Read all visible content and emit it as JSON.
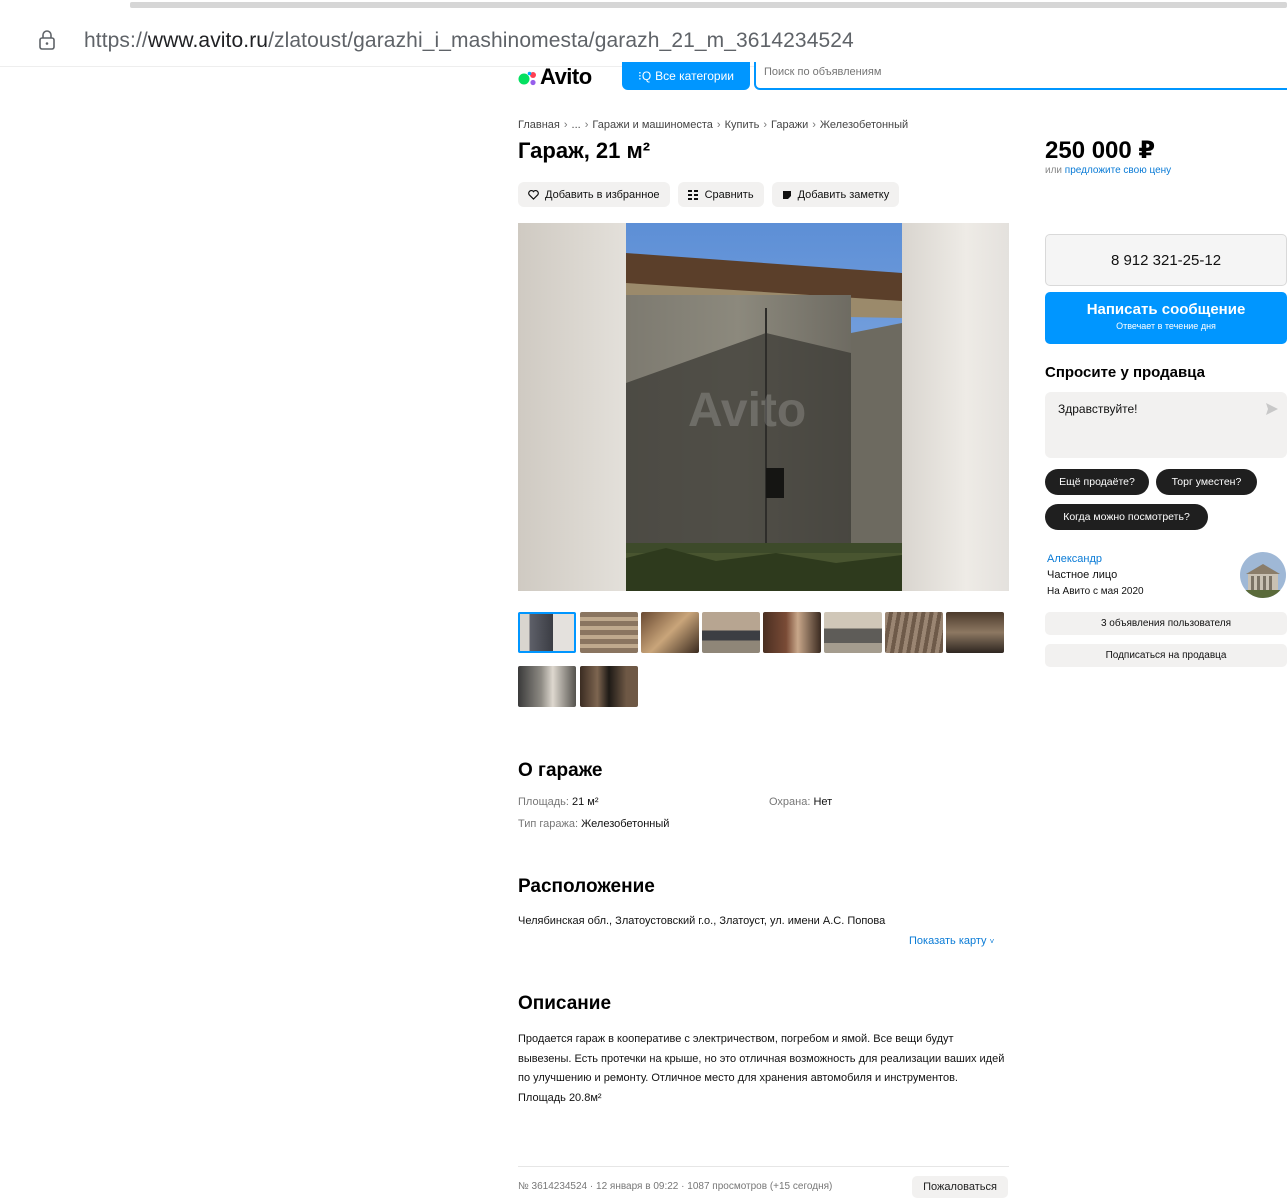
{
  "browser": {
    "url_prefix": "https://",
    "url_host": "www.avito.ru",
    "url_path": "/zlatoust/garazhi_i_mashinomesta/garazh_21_m_3614234524"
  },
  "header": {
    "logo": "Avito",
    "categories_button": "Все категории",
    "search_placeholder": "Поиск по объявлениям"
  },
  "breadcrumbs": [
    "Главная",
    "...",
    "Гаражи и машиноместа",
    "Купить",
    "Гаражи",
    "Железобетонный"
  ],
  "listing": {
    "title": "Гараж, 21 м²",
    "actions": {
      "favorite": "Добавить в избранное",
      "compare": "Сравнить",
      "note": "Добавить заметку"
    },
    "watermark": "Avito"
  },
  "about": {
    "heading": "О гараже",
    "area_label": "Площадь:",
    "area_value": "21 м²",
    "security_label": "Охрана:",
    "security_value": "Нет",
    "type_label": "Тип гаража:",
    "type_value": "Железобетонный"
  },
  "location": {
    "heading": "Расположение",
    "address": "Челябинская обл., Златоустовский г.о., Златоуст, ул. имени А.С. Попова",
    "map_link": "Показать карту"
  },
  "description": {
    "heading": "Описание",
    "text": "Продается гараж в кооперативе с электричеством, погребом и ямой. Все вещи будут вывезены. Есть протечки на крыше, но это отличная возможность для реализации ваших идей по улучшению и ремонту. Отличное место для хранения автомобиля и инструментов.",
    "area_line": "Площадь 20.8м²"
  },
  "footer": {
    "meta": "№ 3614234524 · 12 января в 09:22 · 1087 просмотров (+15 сегодня)",
    "complain": "Пожаловаться"
  },
  "sidebar": {
    "price": "250 000 ₽",
    "offer_prefix": "или",
    "offer_link": "предложите свою цену",
    "phone": "8 912 321-25-12",
    "message_button": "Написать сообщение",
    "message_sub": "Отвечает в течение дня",
    "ask_title": "Спросите у продавца",
    "ask_text": "Здравствуйте!",
    "chips": [
      "Ещё продаёте?",
      "Торг уместен?",
      "Когда можно посмотреть?"
    ],
    "seller_name": "Александр",
    "seller_type": "Частное лицо",
    "seller_since": "На Авито с мая 2020",
    "listings_button": "3 объявления пользователя",
    "subscribe_button": "Подписаться на продавца"
  },
  "colors": {
    "accent": "#0096ff",
    "link": "#0a7bd6",
    "chip": "#1f1f1f"
  }
}
